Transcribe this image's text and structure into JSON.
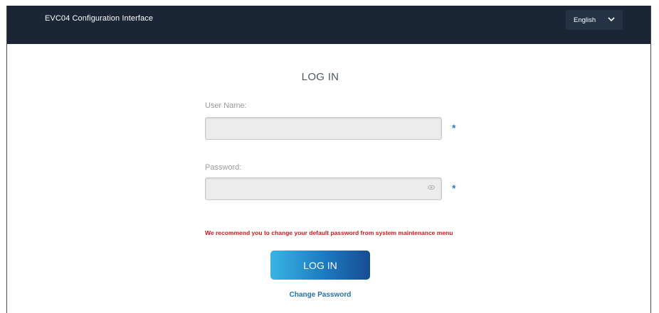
{
  "header": {
    "app_title": "EVC04 Configuration Interface",
    "language": {
      "selected": "English",
      "icon": "chevron-down-icon"
    }
  },
  "login": {
    "title": "LOG IN",
    "username": {
      "label": "User Name:",
      "value": "",
      "placeholder": "",
      "required_mark": "*"
    },
    "password": {
      "label": "Password:",
      "value": "",
      "placeholder": "",
      "required_mark": "*",
      "icon": "eye-icon"
    },
    "warning": "We recommend you to change your default password from system maintenance menu",
    "submit_label": "LOG IN",
    "change_password_label": "Change Password"
  },
  "colors": {
    "header_bg": "#1a2536",
    "accent": "#2b7fc4",
    "warning": "#d0161e",
    "button_gradient_start": "#39b4e4",
    "button_gradient_end": "#164d93"
  }
}
